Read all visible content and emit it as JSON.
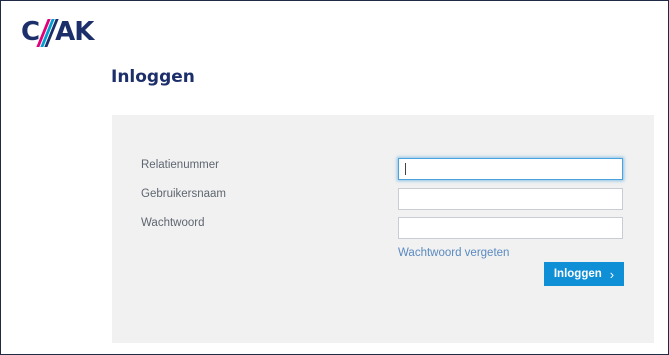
{
  "logo": {
    "text_left": "C",
    "text_right": "AK",
    "colors": {
      "navy": "#1c2f6b",
      "magenta": "#e2007a",
      "cyan": "#00a0d2"
    }
  },
  "page": {
    "title": "Inloggen"
  },
  "form": {
    "relatienummer": {
      "label": "Relatienummer",
      "value": ""
    },
    "gebruikersnaam": {
      "label": "Gebruikersnaam",
      "value": ""
    },
    "wachtwoord": {
      "label": "Wachtwoord",
      "value": ""
    },
    "forgot_link": "Wachtwoord vergeten",
    "submit_label": "Inloggen",
    "submit_icon": "chevron-right-icon",
    "accent_color": "#0f8fd6"
  }
}
